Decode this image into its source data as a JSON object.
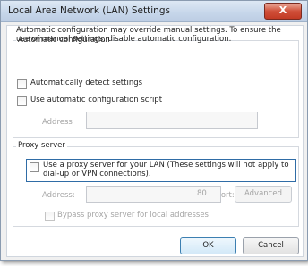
{
  "window": {
    "title": "Local Area Network (LAN) Settings",
    "close_label": "X"
  },
  "automatic": {
    "group_title": "Automatic configuration",
    "description": "Automatic configuration may override manual settings.  To ensure the use of manual settings, disable automatic configuration.",
    "detect_label": "Automatically detect settings",
    "detect_checked": false,
    "script_label": "Use automatic configuration script",
    "script_checked": false,
    "address_label": "Address",
    "address_value": ""
  },
  "proxy": {
    "group_title": "Proxy server",
    "use_proxy_label": "Use a proxy server for your LAN (These settings will not apply to dial-up or VPN connections).",
    "use_proxy_checked": false,
    "address_label": "Address:",
    "address_value": "",
    "port_label": "Port:",
    "port_value": "80",
    "advanced_label": "Advanced",
    "bypass_label": "Bypass proxy server for local addresses",
    "bypass_checked": false
  },
  "buttons": {
    "ok_label": "OK",
    "cancel_label": "Cancel"
  }
}
